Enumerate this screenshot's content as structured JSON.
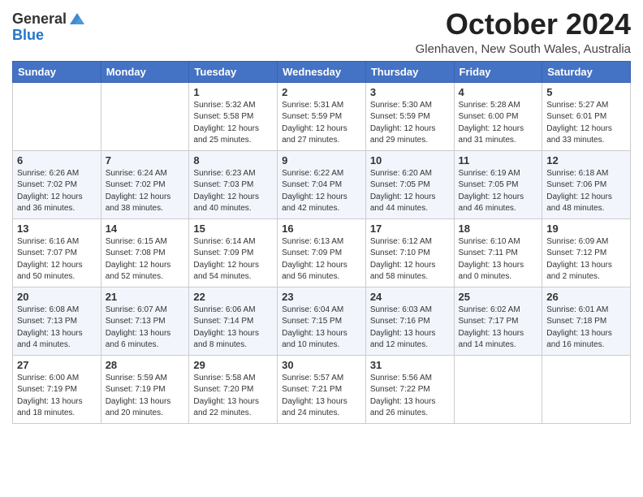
{
  "header": {
    "logo_line1": "General",
    "logo_line2": "Blue",
    "month": "October 2024",
    "location": "Glenhaven, New South Wales, Australia"
  },
  "days_of_week": [
    "Sunday",
    "Monday",
    "Tuesday",
    "Wednesday",
    "Thursday",
    "Friday",
    "Saturday"
  ],
  "weeks": [
    [
      {
        "day": "",
        "info": ""
      },
      {
        "day": "",
        "info": ""
      },
      {
        "day": "1",
        "info": "Sunrise: 5:32 AM\nSunset: 5:58 PM\nDaylight: 12 hours\nand 25 minutes."
      },
      {
        "day": "2",
        "info": "Sunrise: 5:31 AM\nSunset: 5:59 PM\nDaylight: 12 hours\nand 27 minutes."
      },
      {
        "day": "3",
        "info": "Sunrise: 5:30 AM\nSunset: 5:59 PM\nDaylight: 12 hours\nand 29 minutes."
      },
      {
        "day": "4",
        "info": "Sunrise: 5:28 AM\nSunset: 6:00 PM\nDaylight: 12 hours\nand 31 minutes."
      },
      {
        "day": "5",
        "info": "Sunrise: 5:27 AM\nSunset: 6:01 PM\nDaylight: 12 hours\nand 33 minutes."
      }
    ],
    [
      {
        "day": "6",
        "info": "Sunrise: 6:26 AM\nSunset: 7:02 PM\nDaylight: 12 hours\nand 36 minutes."
      },
      {
        "day": "7",
        "info": "Sunrise: 6:24 AM\nSunset: 7:02 PM\nDaylight: 12 hours\nand 38 minutes."
      },
      {
        "day": "8",
        "info": "Sunrise: 6:23 AM\nSunset: 7:03 PM\nDaylight: 12 hours\nand 40 minutes."
      },
      {
        "day": "9",
        "info": "Sunrise: 6:22 AM\nSunset: 7:04 PM\nDaylight: 12 hours\nand 42 minutes."
      },
      {
        "day": "10",
        "info": "Sunrise: 6:20 AM\nSunset: 7:05 PM\nDaylight: 12 hours\nand 44 minutes."
      },
      {
        "day": "11",
        "info": "Sunrise: 6:19 AM\nSunset: 7:05 PM\nDaylight: 12 hours\nand 46 minutes."
      },
      {
        "day": "12",
        "info": "Sunrise: 6:18 AM\nSunset: 7:06 PM\nDaylight: 12 hours\nand 48 minutes."
      }
    ],
    [
      {
        "day": "13",
        "info": "Sunrise: 6:16 AM\nSunset: 7:07 PM\nDaylight: 12 hours\nand 50 minutes."
      },
      {
        "day": "14",
        "info": "Sunrise: 6:15 AM\nSunset: 7:08 PM\nDaylight: 12 hours\nand 52 minutes."
      },
      {
        "day": "15",
        "info": "Sunrise: 6:14 AM\nSunset: 7:09 PM\nDaylight: 12 hours\nand 54 minutes."
      },
      {
        "day": "16",
        "info": "Sunrise: 6:13 AM\nSunset: 7:09 PM\nDaylight: 12 hours\nand 56 minutes."
      },
      {
        "day": "17",
        "info": "Sunrise: 6:12 AM\nSunset: 7:10 PM\nDaylight: 12 hours\nand 58 minutes."
      },
      {
        "day": "18",
        "info": "Sunrise: 6:10 AM\nSunset: 7:11 PM\nDaylight: 13 hours\nand 0 minutes."
      },
      {
        "day": "19",
        "info": "Sunrise: 6:09 AM\nSunset: 7:12 PM\nDaylight: 13 hours\nand 2 minutes."
      }
    ],
    [
      {
        "day": "20",
        "info": "Sunrise: 6:08 AM\nSunset: 7:13 PM\nDaylight: 13 hours\nand 4 minutes."
      },
      {
        "day": "21",
        "info": "Sunrise: 6:07 AM\nSunset: 7:13 PM\nDaylight: 13 hours\nand 6 minutes."
      },
      {
        "day": "22",
        "info": "Sunrise: 6:06 AM\nSunset: 7:14 PM\nDaylight: 13 hours\nand 8 minutes."
      },
      {
        "day": "23",
        "info": "Sunrise: 6:04 AM\nSunset: 7:15 PM\nDaylight: 13 hours\nand 10 minutes."
      },
      {
        "day": "24",
        "info": "Sunrise: 6:03 AM\nSunset: 7:16 PM\nDaylight: 13 hours\nand 12 minutes."
      },
      {
        "day": "25",
        "info": "Sunrise: 6:02 AM\nSunset: 7:17 PM\nDaylight: 13 hours\nand 14 minutes."
      },
      {
        "day": "26",
        "info": "Sunrise: 6:01 AM\nSunset: 7:18 PM\nDaylight: 13 hours\nand 16 minutes."
      }
    ],
    [
      {
        "day": "27",
        "info": "Sunrise: 6:00 AM\nSunset: 7:19 PM\nDaylight: 13 hours\nand 18 minutes."
      },
      {
        "day": "28",
        "info": "Sunrise: 5:59 AM\nSunset: 7:19 PM\nDaylight: 13 hours\nand 20 minutes."
      },
      {
        "day": "29",
        "info": "Sunrise: 5:58 AM\nSunset: 7:20 PM\nDaylight: 13 hours\nand 22 minutes."
      },
      {
        "day": "30",
        "info": "Sunrise: 5:57 AM\nSunset: 7:21 PM\nDaylight: 13 hours\nand 24 minutes."
      },
      {
        "day": "31",
        "info": "Sunrise: 5:56 AM\nSunset: 7:22 PM\nDaylight: 13 hours\nand 26 minutes."
      },
      {
        "day": "",
        "info": ""
      },
      {
        "day": "",
        "info": ""
      }
    ]
  ]
}
